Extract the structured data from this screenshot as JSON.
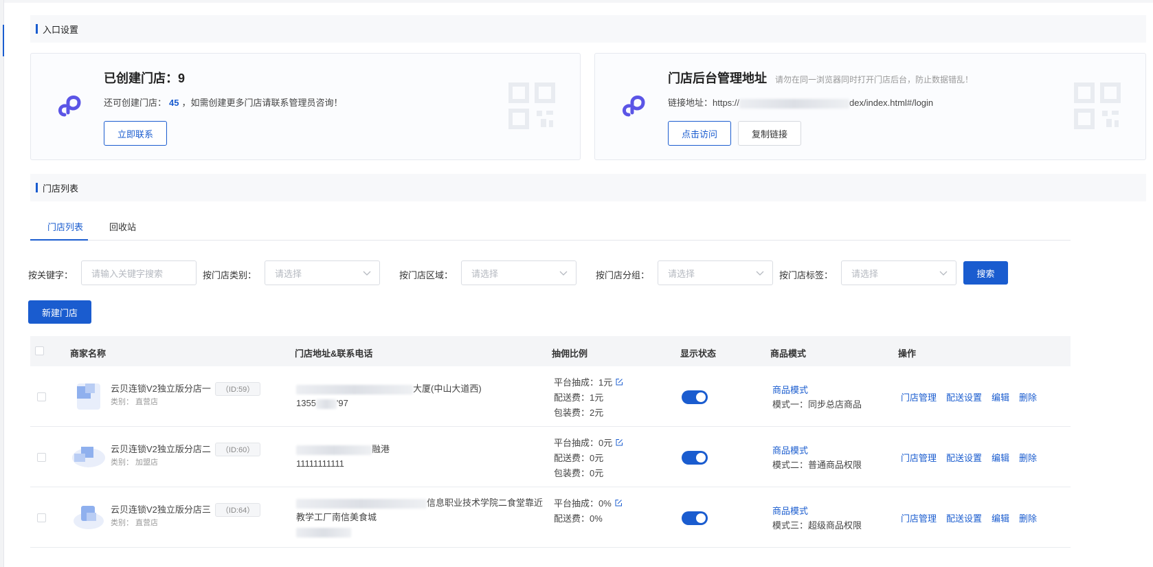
{
  "entry_section": {
    "title": "入口设置"
  },
  "store_card": {
    "title": "已创建门店：9",
    "desc_prefix": "还可创建门店：",
    "remaining": "45",
    "desc_suffix": "，如需创建更多门店请联系管理员咨询！",
    "contact_button": "立即联系"
  },
  "admin_card": {
    "title": "门店后台管理地址",
    "hint": "请勿在同一浏览器同时打开门店后台，防止数据错乱！",
    "link_prefix": "链接地址：https://",
    "link_suffix": "dex/index.html#/login",
    "visit_button": "点击访问",
    "copy_button": "复制链接"
  },
  "list_section": {
    "title": "门店列表"
  },
  "tabs": [
    {
      "label": "门店列表"
    },
    {
      "label": "回收站"
    }
  ],
  "filters": {
    "keyword_label": "按关键字：",
    "keyword_placeholder": "请输入关键字搜索",
    "category_label": "按门店类别：",
    "region_label": "按门店区域：",
    "group_label": "按门店分组：",
    "tag_label": "按门店标签：",
    "select_placeholder": "请选择",
    "search_button": "搜索"
  },
  "new_store_button": "新建门店",
  "table": {
    "headers": {
      "name": "商家名称",
      "address": "门店地址&联系电话",
      "commission": "抽佣比例",
      "status": "显示状态",
      "mode": "商品模式",
      "actions": "操作"
    },
    "rows": [
      {
        "name": "云贝连锁V2独立版分店一",
        "id": "（ID:59）",
        "category": "类别：  直营店",
        "addr_line1": "大厦(中山大道西)",
        "phone_prefix": "1355",
        "phone_suffix": "'97",
        "platform_fee": "平台抽成：1元",
        "delivery_fee": "配送费：1元",
        "package_fee": "包装费：2元",
        "mode_link": "商品模式",
        "mode_text": "模式一：同步总店商品"
      },
      {
        "name": "云贝连锁V2独立版分店二",
        "id": "（ID:60）",
        "category": "类别：  加盟店",
        "addr_line1": "融港",
        "phone": "11111111111",
        "platform_fee": "平台抽成：0元",
        "delivery_fee": "配送费：0元",
        "package_fee": "包装费：0元",
        "mode_link": "商品模式",
        "mode_text": "模式二：普通商品权限"
      },
      {
        "name": "云贝连锁V2独立版分店三",
        "id": "（ID:64）",
        "category": "类别：  直营店",
        "addr_line1": "信息职业技术学院二食堂靠近",
        "addr_line2": "教学工厂南信美食城",
        "platform_fee": "平台抽成：0%",
        "delivery_fee": "配送费：0%",
        "mode_link": "商品模式",
        "mode_text": "模式三：超级商品权限"
      }
    ],
    "actions": [
      "门店管理",
      "配送设置",
      "编辑",
      "删除"
    ]
  },
  "colors": {
    "primary": "#1a5ccf",
    "logo": "#5b55e6"
  }
}
